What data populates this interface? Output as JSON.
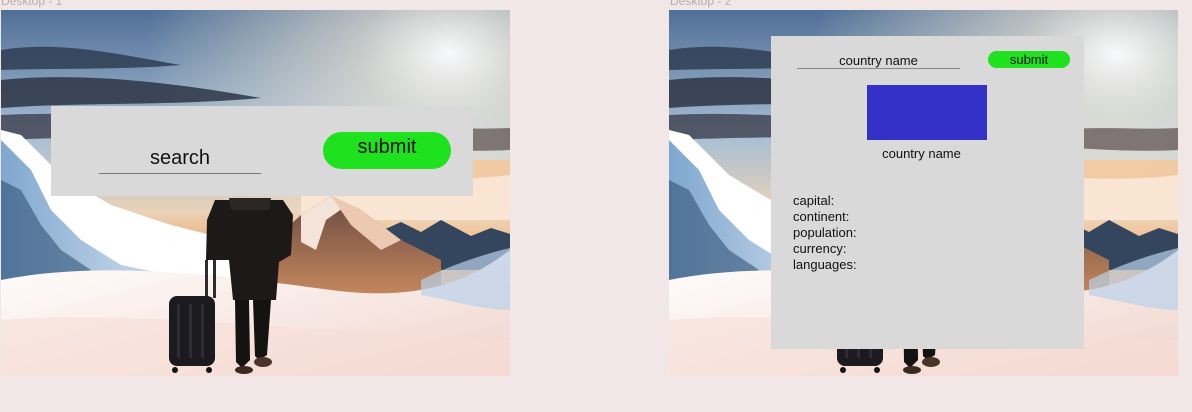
{
  "frames": [
    {
      "label": "Desktop - 1"
    },
    {
      "label": "Desktop - 2"
    }
  ],
  "desktop1": {
    "search_placeholder": "search",
    "submit_label": "submit"
  },
  "desktop2": {
    "country_placeholder": "country name",
    "submit_label": "submit",
    "country_label": "country name",
    "details": [
      {
        "label": "capital:"
      },
      {
        "label": "continent:"
      },
      {
        "label": "population:"
      },
      {
        "label": "currency:"
      },
      {
        "label": "languages:"
      }
    ]
  },
  "colors": {
    "canvas": "#f1e7e7",
    "panel": "#d9d9d9",
    "accent_green": "#1ee21e",
    "flag_blue": "#3431c8"
  }
}
